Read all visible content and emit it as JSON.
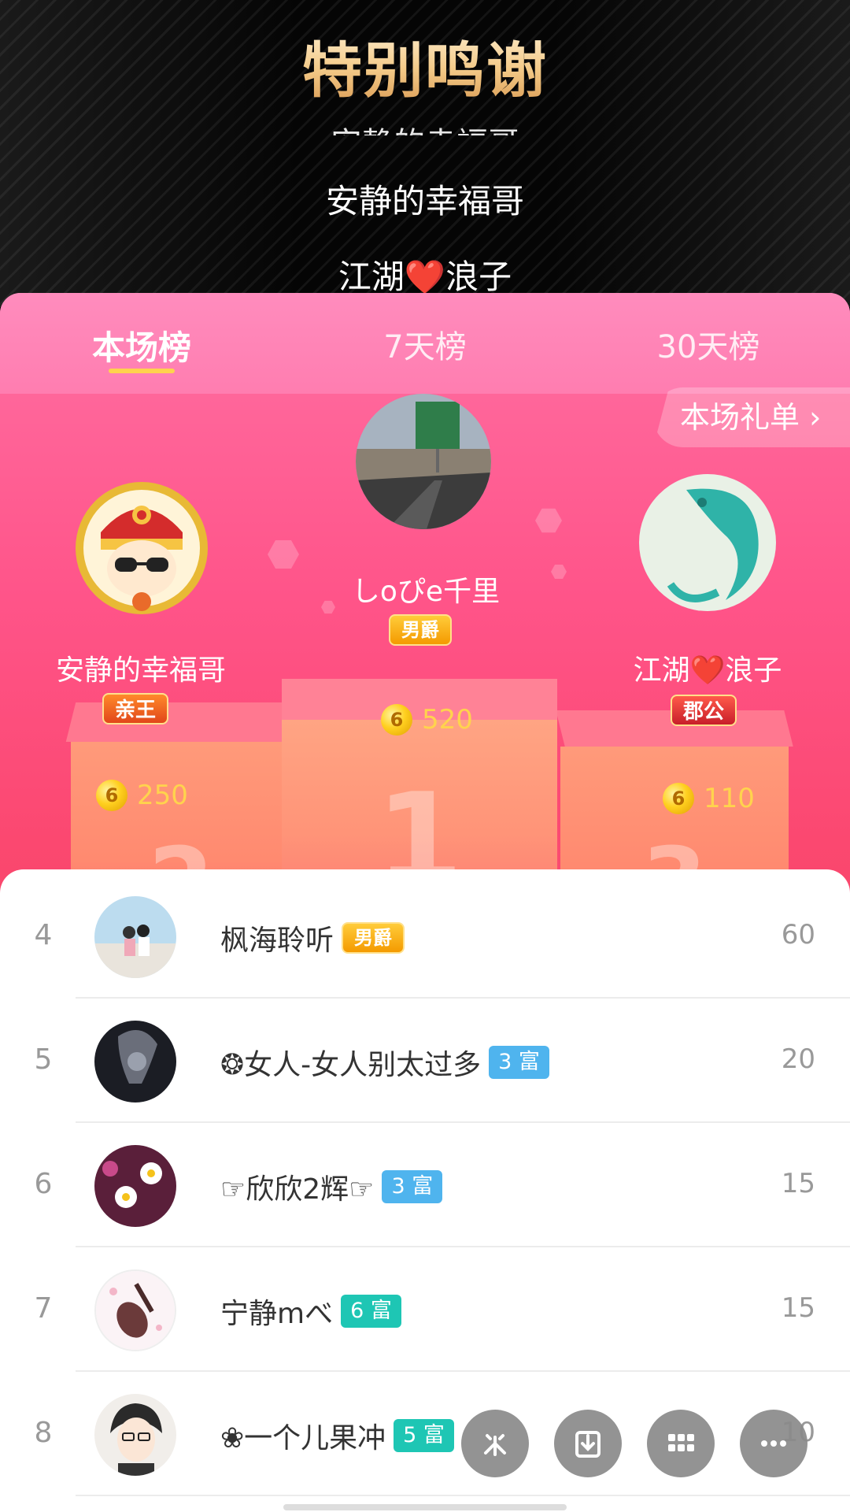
{
  "banner": {
    "title": "特别鸣谢",
    "faded_line": "安静的幸福哥",
    "thanks": [
      "安静的幸福哥",
      "江湖❤️浪子"
    ]
  },
  "tabs": [
    {
      "label": "本场榜",
      "active": true
    },
    {
      "label": "7天榜",
      "active": false
    },
    {
      "label": "30天榜",
      "active": false
    }
  ],
  "gift_list_button": "本场礼单 ›",
  "top3": [
    {
      "rank": 2,
      "name": "安静的幸福哥",
      "badge": "亲王",
      "coin_icon": "6",
      "value": "250"
    },
    {
      "rank": 1,
      "name": "しoぴe千里",
      "badge": "男爵",
      "coin_icon": "6",
      "value": "520"
    },
    {
      "rank": 3,
      "name": "江湖❤️浪子",
      "badge": "郡公",
      "coin_icon": "6",
      "value": "110"
    }
  ],
  "podium_numbers": [
    "2",
    "1",
    "3"
  ],
  "list": [
    {
      "rank": "4",
      "name": "枫海聆听",
      "tag": "男爵",
      "tag_type": "noble",
      "score": "60"
    },
    {
      "rank": "5",
      "name": "❂女人-女人别太过多",
      "tag": "3 富",
      "tag_type": "wealth",
      "tag_color": "#4fb4ee",
      "score": "20"
    },
    {
      "rank": "6",
      "name": "☞欣欣2辉☞",
      "tag": "3 富",
      "tag_type": "wealth",
      "tag_color": "#4fb4ee",
      "score": "15"
    },
    {
      "rank": "7",
      "name": "宁静mべ",
      "tag": "6 富",
      "tag_type": "wealth",
      "tag_color": "#1ec6b4",
      "score": "15"
    },
    {
      "rank": "8",
      "name": "❀一个儿果冲",
      "tag": "5 富",
      "tag_type": "wealth",
      "tag_color": "#1ec6b4",
      "score": "10"
    }
  ],
  "colors": {
    "accent_pink": "#ff5489",
    "gold": "#ffd34d",
    "wealth_blue": "#4fb4ee",
    "wealth_teal": "#1ec6b4"
  },
  "fabs": [
    "sparkle-icon",
    "download-icon",
    "grid-icon",
    "more-icon"
  ]
}
